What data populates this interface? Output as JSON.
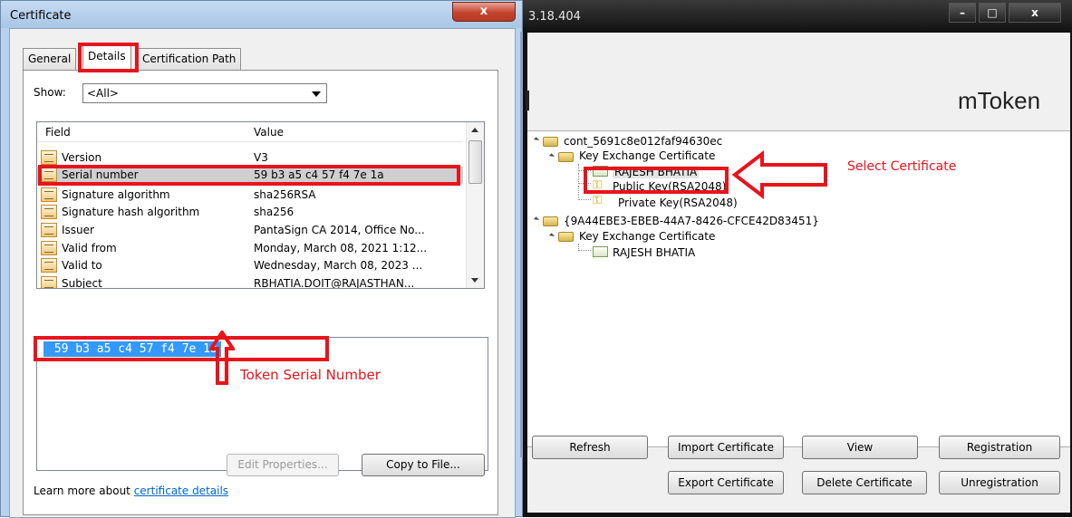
{
  "cert_dialog": {
    "title": "Certificate",
    "close_label": "x",
    "tabs": [
      "General",
      "Details",
      "Certification Path"
    ],
    "show_label": "Show:",
    "show_value": "<All>",
    "columns": [
      "Field",
      "Value"
    ],
    "rows": [
      {
        "field": "Version",
        "value": "V3"
      },
      {
        "field": "Serial number",
        "value": "59 b3 a5 c4 57 f4 7e 1a"
      },
      {
        "field": "Signature algorithm",
        "value": "sha256RSA"
      },
      {
        "field": "Signature hash algorithm",
        "value": "sha256"
      },
      {
        "field": "Issuer",
        "value": "PantaSign CA 2014, Office No..."
      },
      {
        "field": "Valid from",
        "value": "Monday, March 08, 2021 1:12..."
      },
      {
        "field": "Valid to",
        "value": "Wednesday, March 08, 2023 ..."
      },
      {
        "field": "Subject",
        "value": "RBHATIA.DOIT@RAJASTHAN..."
      }
    ],
    "selected_value": " 59 b3 a5 c4 57 f4 7e 1a",
    "annotation": "Token Serial Number",
    "edit_properties": "Edit Properties...",
    "copy_to_file": "Copy to File...",
    "learn_more_prefix": "Learn more about ",
    "learn_more_link": "certificate details"
  },
  "mtoken": {
    "title": "3.18.404",
    "brand": "mToken",
    "tree": {
      "container1": "cont_5691c8e012faf94630ec",
      "kec1": "Key Exchange Certificate",
      "cert1": "RAJESH BHATIA",
      "pubkey": "Public Key(RSA2048)",
      "privkey": "Private Key(RSA2048)",
      "container2": "{9A44EBE3-EBEB-44A7-8426-CFCE42D83451}",
      "kec2": "Key Exchange Certificate",
      "cert2": "RAJESH BHATIA"
    },
    "annotation": "Select Certificate",
    "buttons": {
      "refresh": "Refresh",
      "import": "Import Certificate",
      "view": "View",
      "registration": "Registration",
      "export": "Export Certificate",
      "delete": "Delete Certificate",
      "unregistration": "Unregistration"
    }
  },
  "colors": {
    "annotation_red": "#e8141b",
    "selection_blue": "#3399ff"
  },
  "icons": [
    "close-icon",
    "dropdown-arrow-icon",
    "certificate-field-icon",
    "folder-icon",
    "certificate-icon",
    "key-icon",
    "arrow-up-icon",
    "arrow-left-icon",
    "minimize-icon",
    "maximize-icon"
  ]
}
